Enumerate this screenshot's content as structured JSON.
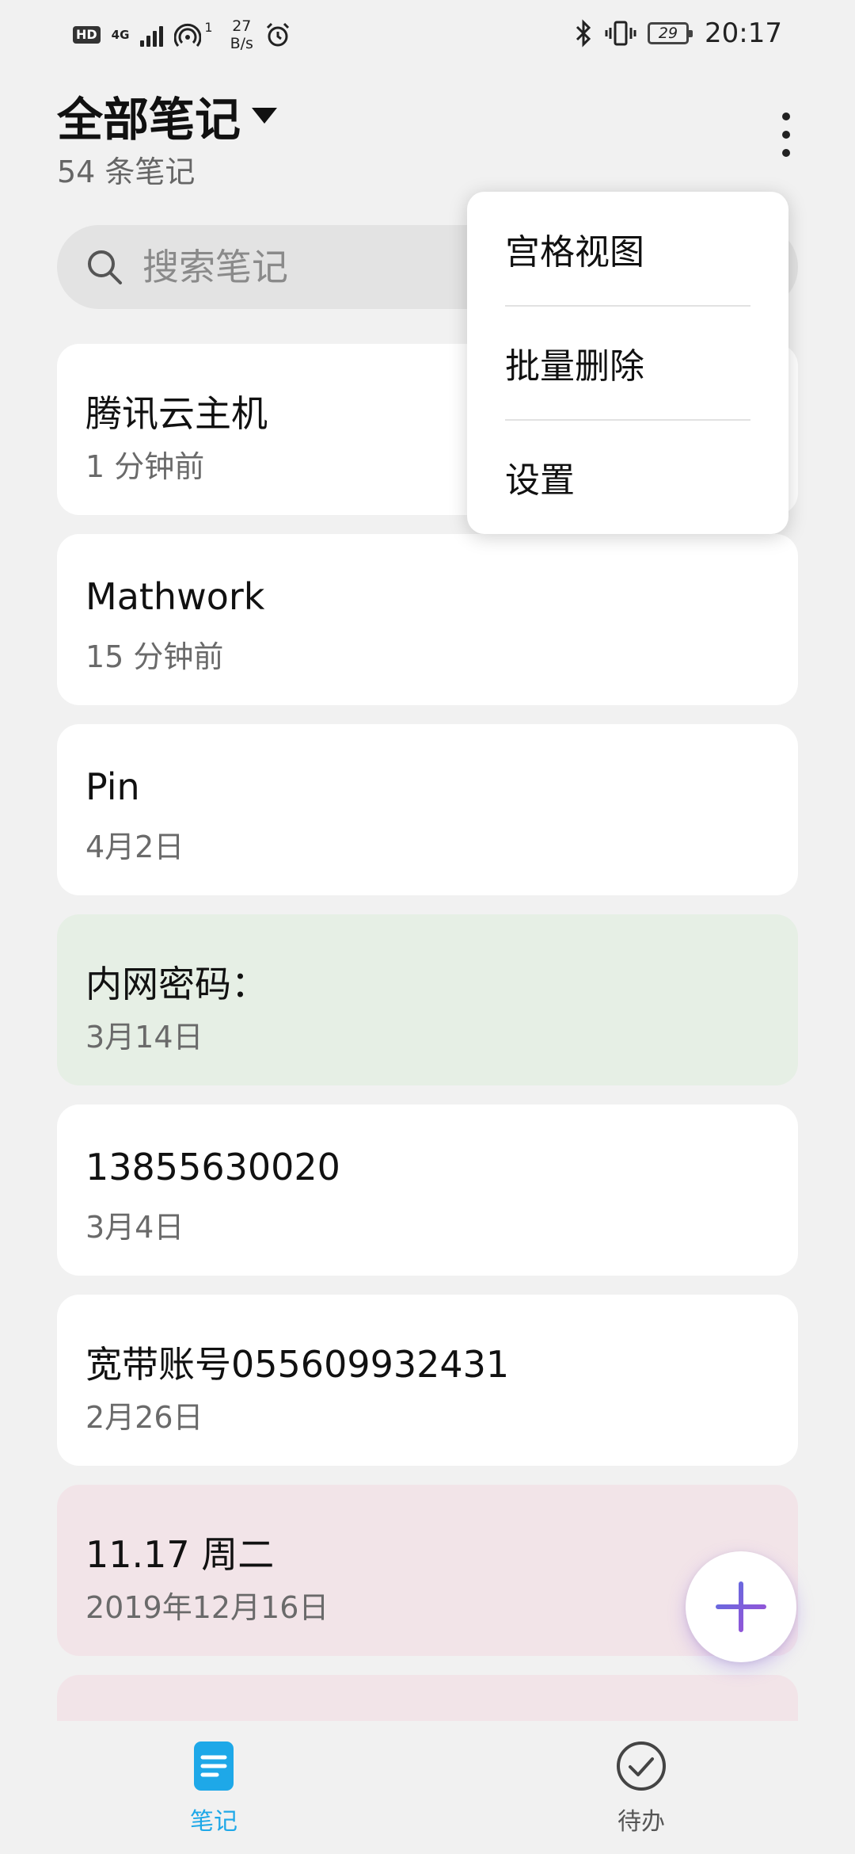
{
  "status_bar": {
    "hd": "HD",
    "network": "4G",
    "sim_number": "1",
    "speed_value": "27",
    "speed_unit": "B/s",
    "battery_level": "29",
    "time": "20:17",
    "icons": [
      "signal-icon",
      "hotspot-icon",
      "alarm-icon",
      "bluetooth-icon",
      "vibrate-icon",
      "battery-icon"
    ]
  },
  "header": {
    "title": "全部笔记",
    "count": "54 条笔记"
  },
  "search": {
    "placeholder": "搜索笔记"
  },
  "notes": [
    {
      "title": "腾讯云主机",
      "time": "1 分钟前",
      "color": "#ffffff"
    },
    {
      "title": "Mathwork",
      "time": "15 分钟前",
      "color": "#ffffff"
    },
    {
      "title": "Pin",
      "time": "4月2日",
      "color": "#ffffff"
    },
    {
      "title": "内网密码：",
      "time": "3月14日",
      "color": "#e6efe5"
    },
    {
      "title": "13855630020",
      "time": "3月4日",
      "color": "#ffffff"
    },
    {
      "title": "宽带账号055609932431",
      "time": "2月26日",
      "color": "#ffffff"
    },
    {
      "title": "11.17 周二",
      "time": "2019年12月16日",
      "color": "#f2e4e8"
    }
  ],
  "menu": {
    "items": [
      "宫格视图",
      "批量删除",
      "设置"
    ]
  },
  "bottom_nav": {
    "notes_label": "笔记",
    "todo_label": "待办",
    "active_color": "#1ea8e8"
  },
  "fab": {
    "icon": "plus-icon",
    "color": "#7b52d9"
  }
}
